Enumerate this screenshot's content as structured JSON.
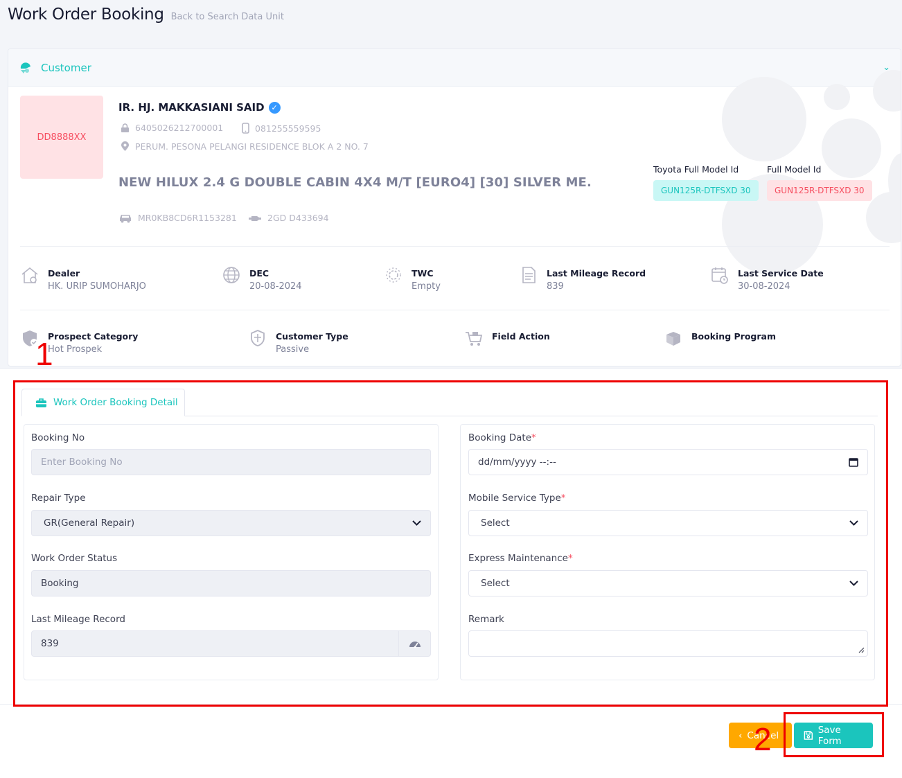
{
  "header": {
    "title": "Work Order Booking",
    "back_link": "Back to Search Data Unit"
  },
  "customer_section": {
    "title": "Customer"
  },
  "customer": {
    "plate": "DD8888XX",
    "name": "IR. HJ. MAKKASIANI SAID",
    "id_number": "6405026212700001",
    "phone": "081255559595",
    "address": "PERUM. PESONA PELANGI RESIDENCE BLOK A 2 NO. 7",
    "vehicle": "NEW HILUX 2.4 G DOUBLE CABIN 4X4 M/T [EURO4] [30] SILVER ME.",
    "vin": "MR0KB8CD6R1153281",
    "engine": "2GD D433694",
    "toyota_model_label": "Toyota Full Model Id",
    "toyota_model": "GUN125R-DTFSXD 30",
    "full_model_label": "Full Model Id",
    "full_model": "GUN125R-DTFSXD 30"
  },
  "info_row1": [
    {
      "label": "Dealer",
      "value": "HK. URIP SUMOHARJO",
      "icon": "home-icon"
    },
    {
      "label": "DEC",
      "value": "20-08-2024",
      "icon": "globe-icon"
    },
    {
      "label": "TWC",
      "value": "Empty",
      "icon": "gear-icon"
    },
    {
      "label": "Last Mileage Record",
      "value": "839",
      "icon": "document-icon"
    },
    {
      "label": "Last Service Date",
      "value": "30-08-2024",
      "icon": "calendar-icon"
    }
  ],
  "info_row2": [
    {
      "label": "Prospect Category",
      "value": "Hot Prospek",
      "icon": "shield-check-icon"
    },
    {
      "label": "Customer Type",
      "value": "Passive",
      "icon": "shield-icon"
    },
    {
      "label": "Field Action",
      "value": "",
      "icon": "cart-icon"
    },
    {
      "label": "Booking Program",
      "value": "",
      "icon": "box-icon"
    }
  ],
  "tab": {
    "label": "Work Order Booking Detail"
  },
  "form": {
    "booking_no": {
      "label": "Booking No",
      "placeholder": "Enter Booking No"
    },
    "repair_type": {
      "label": "Repair Type",
      "value": "GR(General Repair)"
    },
    "wo_status": {
      "label": "Work Order Status",
      "value": "Booking"
    },
    "last_mileage": {
      "label": "Last Mileage Record",
      "value": "839"
    },
    "booking_date": {
      "label": "Booking Date",
      "value": "dd/mm/yyyy --:--"
    },
    "mobile_service": {
      "label": "Mobile Service Type",
      "value": "Select"
    },
    "express": {
      "label": "Express Maintenance",
      "value": "Select"
    },
    "remark": {
      "label": "Remark",
      "value": ""
    }
  },
  "actions": {
    "cancel": "Cancel",
    "save": "Save Form"
  },
  "annotations": {
    "one": "1",
    "two": "2"
  },
  "colors": {
    "accent": "#1bc5bd",
    "danger": "#f64e60",
    "warning": "#ffa800",
    "annotation": "#ee0000"
  }
}
